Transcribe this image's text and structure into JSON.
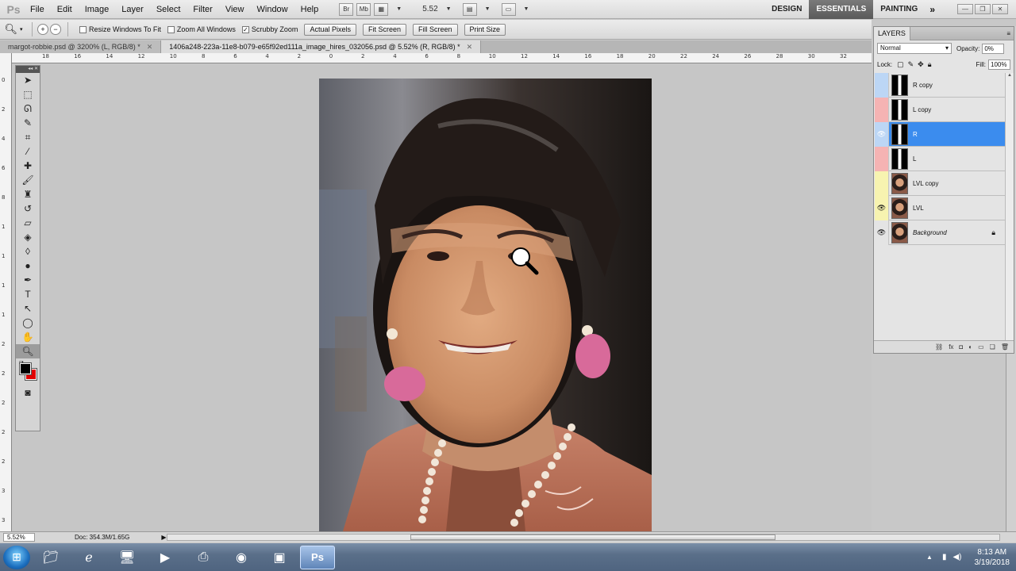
{
  "app": {
    "logo": "Ps"
  },
  "menu": [
    "File",
    "Edit",
    "Image",
    "Layer",
    "Select",
    "Filter",
    "View",
    "Window",
    "Help"
  ],
  "menubar": {
    "bridge_label": "Br",
    "minibridge_label": "Mb",
    "zoom_value": "5.52",
    "workspaces": [
      "DESIGN",
      "ESSENTIALS",
      "PAINTING"
    ],
    "active_workspace": "ESSENTIALS",
    "more_label": "»"
  },
  "options": {
    "resize_windows_to_fit": {
      "label": "Resize Windows To Fit",
      "checked": false
    },
    "zoom_all_windows": {
      "label": "Zoom All Windows",
      "checked": false
    },
    "scrubby_zoom": {
      "label": "Scrubby Zoom",
      "checked": true
    },
    "buttons": [
      "Actual Pixels",
      "Fit Screen",
      "Fill Screen",
      "Print Size"
    ]
  },
  "doc_tabs": [
    {
      "title": "margot-robbie.psd @ 3200% (L, RGB/8) *",
      "active": false
    },
    {
      "title": "1406a248-223a-11e8-b079-e65f92ed111a_image_hires_032056.psd @ 5.52% (R, RGB/8) *",
      "active": true
    }
  ],
  "ruler": {
    "h_ticks": [
      "18",
      "16",
      "14",
      "12",
      "10",
      "8",
      "6",
      "4",
      "2",
      "0",
      "2",
      "4",
      "6",
      "8",
      "10",
      "12",
      "14",
      "16",
      "18",
      "20",
      "22",
      "24",
      "26",
      "28",
      "30",
      "32"
    ],
    "v_ticks": [
      "0",
      "2",
      "4",
      "6",
      "8",
      "1",
      "1",
      "1",
      "1",
      "2",
      "2",
      "2",
      "2",
      "2",
      "3",
      "3"
    ]
  },
  "status": {
    "zoom": "5.52%",
    "doc": "Doc: 354.3M/1.65G"
  },
  "layers_panel": {
    "tab_label": "LAYERS",
    "blend_mode": "Normal",
    "opacity_label": "Opacity:",
    "opacity_value": "0%",
    "lock_label": "Lock:",
    "fill_label": "Fill:",
    "fill_value": "100%",
    "layers": [
      {
        "name": "R copy",
        "visible": false,
        "color": "#bcd6f5",
        "thumb": "mask",
        "selected": false,
        "italic": false,
        "locked": false
      },
      {
        "name": "L copy",
        "visible": false,
        "color": "#f5b3b3",
        "thumb": "mask",
        "selected": false,
        "italic": false,
        "locked": false
      },
      {
        "name": "R",
        "visible": true,
        "color": "#bcd6f5",
        "thumb": "mask",
        "selected": true,
        "italic": false,
        "locked": false
      },
      {
        "name": "L",
        "visible": false,
        "color": "#f5b3b3",
        "thumb": "mask",
        "selected": false,
        "italic": false,
        "locked": false
      },
      {
        "name": "LVL copy",
        "visible": false,
        "color": "#f7f3b0",
        "thumb": "photo",
        "selected": false,
        "italic": false,
        "locked": false
      },
      {
        "name": "LVL",
        "visible": true,
        "color": "#f7f3b0",
        "thumb": "photo",
        "selected": false,
        "italic": false,
        "locked": false
      },
      {
        "name": "Background",
        "visible": true,
        "color": "#e4e4e4",
        "thumb": "photo",
        "selected": false,
        "italic": true,
        "locked": true
      }
    ]
  },
  "taskbar": {
    "apps": [
      "explorer-icon",
      "ie-icon",
      "computer-icon",
      "media-player-icon",
      "hp-icon",
      "chrome-icon",
      "photos-icon",
      "photoshop-icon"
    ],
    "ps_label": "Ps",
    "time": "8:13 AM",
    "date": "3/19/2018"
  },
  "colors": {
    "foreground": "#000000",
    "background": "#e00000",
    "selection": "#3b8cee"
  }
}
